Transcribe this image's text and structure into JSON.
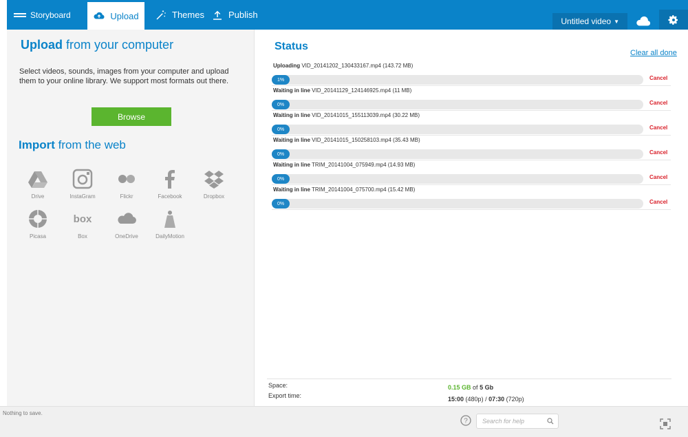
{
  "app": {
    "brand": "Storyboard"
  },
  "tabs": [
    {
      "label": "Upload",
      "icon": "cloud-upload-icon",
      "active": true
    },
    {
      "label": "Themes",
      "icon": "magic-wand-icon",
      "active": false
    },
    {
      "label": "Publish",
      "icon": "upload-arrow-icon",
      "active": false
    }
  ],
  "header": {
    "video_title": "Untitled video",
    "cloud_icon": "cloud-icon",
    "settings_icon": "gear-icon"
  },
  "upload": {
    "heading_bold": "Upload",
    "heading_rest": "from your computer",
    "description": "Select videos, sounds, images from your computer and upload them to your online library. We support most formats out there.",
    "browse_label": "Browse"
  },
  "import": {
    "heading_bold": "Import",
    "heading_rest": "from the web",
    "sources": [
      {
        "label": "Drive",
        "icon": "drive-icon"
      },
      {
        "label": "InstaGram",
        "icon": "instagram-icon"
      },
      {
        "label": "Flickr",
        "icon": "flickr-icon"
      },
      {
        "label": "Facebook",
        "icon": "facebook-icon"
      },
      {
        "label": "Dropbox",
        "icon": "dropbox-icon"
      },
      {
        "label": "Picasa",
        "icon": "picasa-icon"
      },
      {
        "label": "Box",
        "icon": "box-icon"
      },
      {
        "label": "OneDrive",
        "icon": "onedrive-icon"
      },
      {
        "label": "DailyMotion",
        "icon": "dailymotion-icon"
      }
    ]
  },
  "status": {
    "heading": "Status",
    "clear_all": "Clear all done",
    "cancel_label": "Cancel",
    "items": [
      {
        "state": "Uploading",
        "file": "VID_20141202_130433167.mp4 (143.72 MB)",
        "progress": "1%"
      },
      {
        "state": "Waiting in line",
        "file": "VID_20141129_124146925.mp4 (11 MB)",
        "progress": "0%"
      },
      {
        "state": "Waiting in line",
        "file": "VID_20141015_155113039.mp4 (30.22 MB)",
        "progress": "0%"
      },
      {
        "state": "Waiting in line",
        "file": "VID_20141015_150258103.mp4 (35.43 MB)",
        "progress": "0%"
      },
      {
        "state": "Waiting in line",
        "file": "TRIM_20141004_075949.mp4 (14.93 MB)",
        "progress": "0%"
      },
      {
        "state": "Waiting in line",
        "file": "TRIM_20141004_075700.mp4 (15.42 MB)",
        "progress": "0%"
      }
    ]
  },
  "footer_info": {
    "space_label": "Space:",
    "space_used": "0.15 GB",
    "space_of": "of",
    "space_total": "5 Gb",
    "export_label": "Export time:",
    "export_480": "15:00",
    "export_480_res": "(480p) /",
    "export_720": "07:30",
    "export_720_res": "(720p)"
  },
  "statusbar": {
    "message": "Nothing to save.",
    "search_placeholder": "Search for help"
  },
  "colors": {
    "accent": "#0a83c9",
    "browse_green": "#5bb52f",
    "cancel_red": "#d9202a"
  }
}
